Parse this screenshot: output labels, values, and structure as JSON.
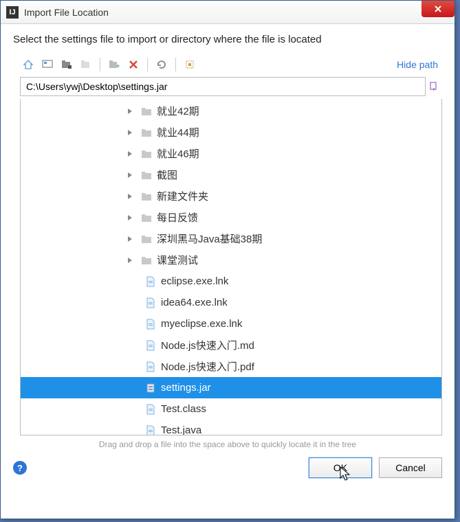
{
  "window": {
    "title": "Import File Location"
  },
  "instruction": "Select the settings file to import or directory where the file is located",
  "toolbar": {
    "hide_path": "Hide path"
  },
  "path": {
    "value": "C:\\Users\\ywj\\Desktop\\settings.jar"
  },
  "tree": [
    {
      "label": "就业42期",
      "type": "folder",
      "expandable": true
    },
    {
      "label": "就业44期",
      "type": "folder",
      "expandable": true
    },
    {
      "label": "就业46期",
      "type": "folder",
      "expandable": true
    },
    {
      "label": "截图",
      "type": "folder",
      "expandable": true
    },
    {
      "label": "新建文件夹",
      "type": "folder",
      "expandable": true
    },
    {
      "label": "每日反馈",
      "type": "folder",
      "expandable": true
    },
    {
      "label": "深圳黑马Java基础38期",
      "type": "folder",
      "expandable": true
    },
    {
      "label": "课堂测试",
      "type": "folder",
      "expandable": true
    },
    {
      "label": "eclipse.exe.lnk",
      "type": "file",
      "expandable": false
    },
    {
      "label": "idea64.exe.lnk",
      "type": "file",
      "expandable": false
    },
    {
      "label": "myeclipse.exe.lnk",
      "type": "file",
      "expandable": false
    },
    {
      "label": "Node.js快速入门.md",
      "type": "file",
      "expandable": false
    },
    {
      "label": "Node.js快速入门.pdf",
      "type": "file",
      "expandable": false
    },
    {
      "label": "settings.jar",
      "type": "file",
      "expandable": false,
      "selected": true
    },
    {
      "label": "Test.class",
      "type": "file",
      "expandable": false
    },
    {
      "label": "Test.java",
      "type": "file",
      "expandable": false
    }
  ],
  "hint": "Drag and drop a file into the space above to quickly locate it in the tree",
  "buttons": {
    "ok": "OK",
    "cancel": "Cancel"
  }
}
